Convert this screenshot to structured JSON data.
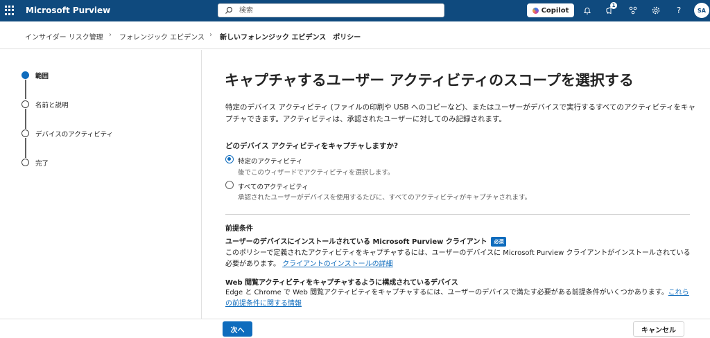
{
  "app": {
    "title": "Microsoft Purview"
  },
  "search": {
    "placeholder": "検索"
  },
  "header": {
    "copilot_label": "Copilot",
    "notification_count": "1",
    "avatar_initials": "SA"
  },
  "breadcrumb": [
    "インサイダー リスク管理",
    "フォレンジック エビデンス",
    "新しいフォレンジック エビデンス　ポリシー"
  ],
  "steps": [
    {
      "label": "範囲",
      "active": true
    },
    {
      "label": "名前と説明",
      "active": false
    },
    {
      "label": "デバイスのアクティビティ",
      "active": false
    },
    {
      "label": "完了",
      "active": false
    }
  ],
  "main": {
    "title": "キャプチャするユーザー アクティビティのスコープを選択する",
    "description": "特定のデバイス アクティビティ (ファイルの印刷や USB へのコピーなど)、またはユーザーがデバイスで実行するすべてのアクティビティをキャプチャできます。アクティビティは、承認されたユーザーに対してのみ記録されます。",
    "question": "どのデバイス アクティビティをキャプチャしますか?",
    "options": [
      {
        "label": "特定のアクティビティ",
        "desc": "後でこのウィザードでアクティビティを選択します。",
        "checked": true
      },
      {
        "label": "すべてのアクティビティ",
        "desc": "承認されたユーザーがデバイスを使用するたびに、すべてのアクティビティがキャプチャされます。",
        "checked": false
      }
    ],
    "prereq_heading": "前提条件",
    "prereqs": [
      {
        "title": "ユーザーのデバイスにインストールされている Microsoft Purview クライアント",
        "badge": "必須",
        "desc": "このポリシーで定義されたアクティビティをキャプチャするには、ユーザーのデバイスに Microsoft Purview クライアントがインストールされている必要があります。",
        "link": "クライアントのインストールの詳細"
      },
      {
        "title": "Web 閲覧アクティビティをキャプチャするように構成されているデバイス",
        "desc": "Edge と Chrome で Web 閲覧アクティビティをキャプチャするには、ユーザーのデバイスで満たす必要がある前提条件がいくつかあります。",
        "link": "これらの前提条件に関する情報"
      }
    ]
  },
  "footer": {
    "next_label": "次へ",
    "cancel_label": "キャンセル"
  },
  "colors": {
    "topbar": "#0f4a7e",
    "accent": "#0f6cbd"
  }
}
